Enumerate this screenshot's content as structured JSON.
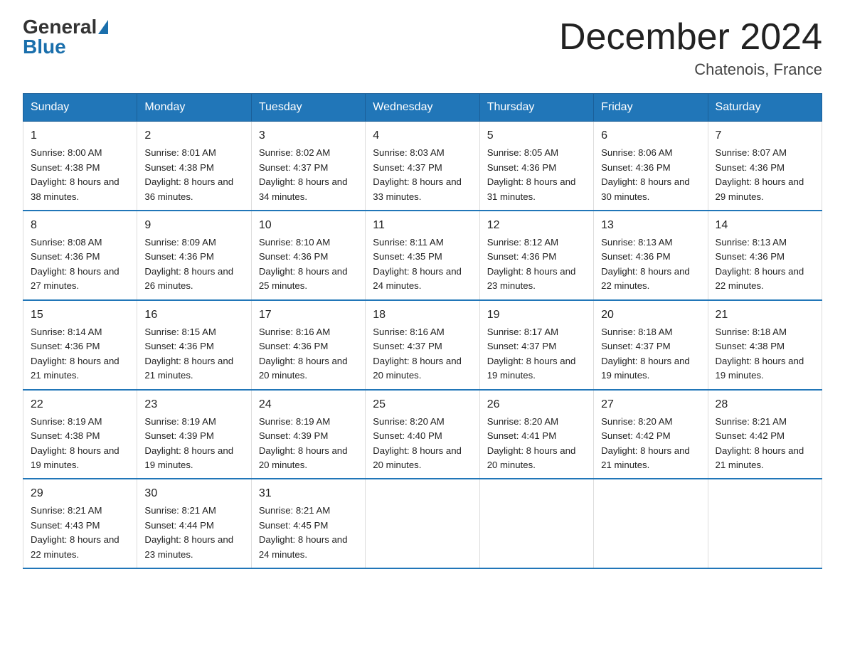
{
  "header": {
    "logo_general": "General",
    "logo_blue": "Blue",
    "month_title": "December 2024",
    "location": "Chatenois, France"
  },
  "days_of_week": [
    "Sunday",
    "Monday",
    "Tuesday",
    "Wednesday",
    "Thursday",
    "Friday",
    "Saturday"
  ],
  "weeks": [
    [
      {
        "num": "1",
        "sunrise": "8:00 AM",
        "sunset": "4:38 PM",
        "daylight": "8 hours and 38 minutes."
      },
      {
        "num": "2",
        "sunrise": "8:01 AM",
        "sunset": "4:38 PM",
        "daylight": "8 hours and 36 minutes."
      },
      {
        "num": "3",
        "sunrise": "8:02 AM",
        "sunset": "4:37 PM",
        "daylight": "8 hours and 34 minutes."
      },
      {
        "num": "4",
        "sunrise": "8:03 AM",
        "sunset": "4:37 PM",
        "daylight": "8 hours and 33 minutes."
      },
      {
        "num": "5",
        "sunrise": "8:05 AM",
        "sunset": "4:36 PM",
        "daylight": "8 hours and 31 minutes."
      },
      {
        "num": "6",
        "sunrise": "8:06 AM",
        "sunset": "4:36 PM",
        "daylight": "8 hours and 30 minutes."
      },
      {
        "num": "7",
        "sunrise": "8:07 AM",
        "sunset": "4:36 PM",
        "daylight": "8 hours and 29 minutes."
      }
    ],
    [
      {
        "num": "8",
        "sunrise": "8:08 AM",
        "sunset": "4:36 PM",
        "daylight": "8 hours and 27 minutes."
      },
      {
        "num": "9",
        "sunrise": "8:09 AM",
        "sunset": "4:36 PM",
        "daylight": "8 hours and 26 minutes."
      },
      {
        "num": "10",
        "sunrise": "8:10 AM",
        "sunset": "4:36 PM",
        "daylight": "8 hours and 25 minutes."
      },
      {
        "num": "11",
        "sunrise": "8:11 AM",
        "sunset": "4:35 PM",
        "daylight": "8 hours and 24 minutes."
      },
      {
        "num": "12",
        "sunrise": "8:12 AM",
        "sunset": "4:36 PM",
        "daylight": "8 hours and 23 minutes."
      },
      {
        "num": "13",
        "sunrise": "8:13 AM",
        "sunset": "4:36 PM",
        "daylight": "8 hours and 22 minutes."
      },
      {
        "num": "14",
        "sunrise": "8:13 AM",
        "sunset": "4:36 PM",
        "daylight": "8 hours and 22 minutes."
      }
    ],
    [
      {
        "num": "15",
        "sunrise": "8:14 AM",
        "sunset": "4:36 PM",
        "daylight": "8 hours and 21 minutes."
      },
      {
        "num": "16",
        "sunrise": "8:15 AM",
        "sunset": "4:36 PM",
        "daylight": "8 hours and 21 minutes."
      },
      {
        "num": "17",
        "sunrise": "8:16 AM",
        "sunset": "4:36 PM",
        "daylight": "8 hours and 20 minutes."
      },
      {
        "num": "18",
        "sunrise": "8:16 AM",
        "sunset": "4:37 PM",
        "daylight": "8 hours and 20 minutes."
      },
      {
        "num": "19",
        "sunrise": "8:17 AM",
        "sunset": "4:37 PM",
        "daylight": "8 hours and 19 minutes."
      },
      {
        "num": "20",
        "sunrise": "8:18 AM",
        "sunset": "4:37 PM",
        "daylight": "8 hours and 19 minutes."
      },
      {
        "num": "21",
        "sunrise": "8:18 AM",
        "sunset": "4:38 PM",
        "daylight": "8 hours and 19 minutes."
      }
    ],
    [
      {
        "num": "22",
        "sunrise": "8:19 AM",
        "sunset": "4:38 PM",
        "daylight": "8 hours and 19 minutes."
      },
      {
        "num": "23",
        "sunrise": "8:19 AM",
        "sunset": "4:39 PM",
        "daylight": "8 hours and 19 minutes."
      },
      {
        "num": "24",
        "sunrise": "8:19 AM",
        "sunset": "4:39 PM",
        "daylight": "8 hours and 20 minutes."
      },
      {
        "num": "25",
        "sunrise": "8:20 AM",
        "sunset": "4:40 PM",
        "daylight": "8 hours and 20 minutes."
      },
      {
        "num": "26",
        "sunrise": "8:20 AM",
        "sunset": "4:41 PM",
        "daylight": "8 hours and 20 minutes."
      },
      {
        "num": "27",
        "sunrise": "8:20 AM",
        "sunset": "4:42 PM",
        "daylight": "8 hours and 21 minutes."
      },
      {
        "num": "28",
        "sunrise": "8:21 AM",
        "sunset": "4:42 PM",
        "daylight": "8 hours and 21 minutes."
      }
    ],
    [
      {
        "num": "29",
        "sunrise": "8:21 AM",
        "sunset": "4:43 PM",
        "daylight": "8 hours and 22 minutes."
      },
      {
        "num": "30",
        "sunrise": "8:21 AM",
        "sunset": "4:44 PM",
        "daylight": "8 hours and 23 minutes."
      },
      {
        "num": "31",
        "sunrise": "8:21 AM",
        "sunset": "4:45 PM",
        "daylight": "8 hours and 24 minutes."
      },
      null,
      null,
      null,
      null
    ]
  ]
}
